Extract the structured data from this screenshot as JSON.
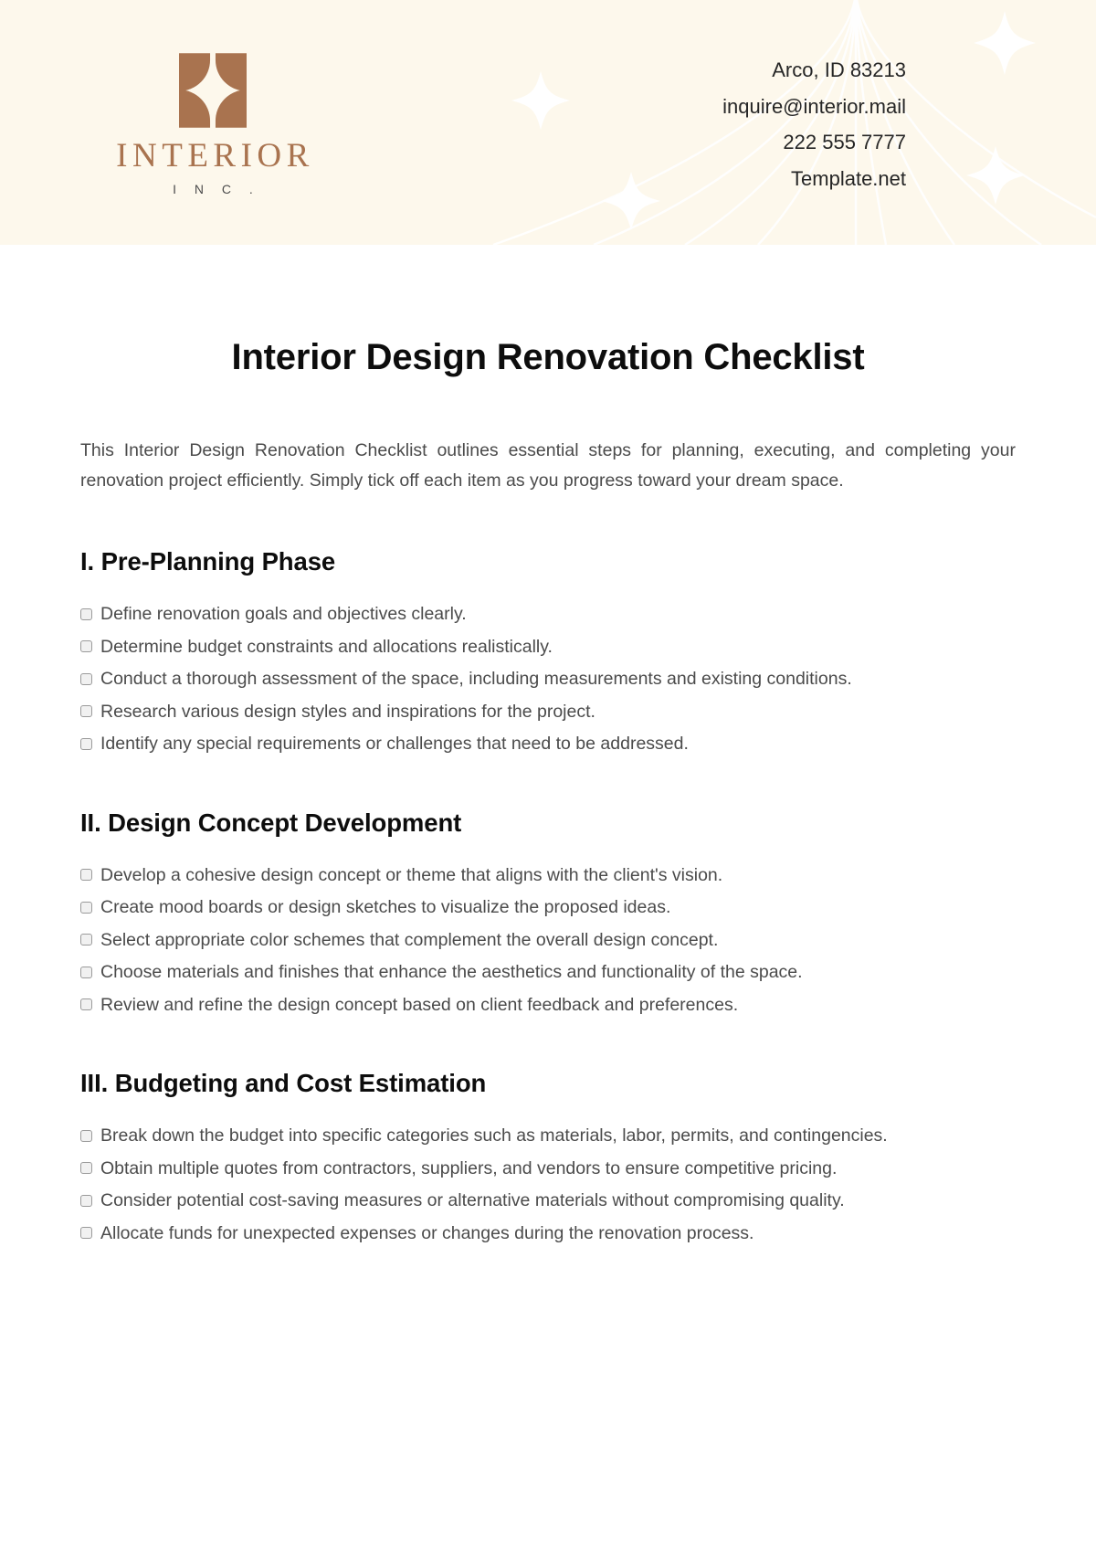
{
  "header": {
    "logo": {
      "mark_name": "interior-inc-logo-mark",
      "wordmark": "INTERIOR",
      "subtitle": "I N C .",
      "brand_color": "#a9734f"
    },
    "contact": [
      "Arco, ID 83213",
      "inquire@interior.mail",
      "222 555 7777",
      "Template.net"
    ],
    "background_color": "#fdf8ec",
    "decoration": "globe-meridian-lines-and-sparkles"
  },
  "document": {
    "title": "Interior Design Renovation Checklist",
    "intro": "This Interior Design Renovation Checklist outlines essential steps for planning, executing, and completing your renovation project efficiently. Simply tick off each item as you progress toward your dream space."
  },
  "sections": [
    {
      "heading": "I. Pre-Planning Phase",
      "items": [
        {
          "label": "Define renovation goals and objectives clearly.",
          "checked": false,
          "multiline": false
        },
        {
          "label": "Determine budget constraints and allocations realistically.",
          "checked": false,
          "multiline": false
        },
        {
          "label": "Conduct a thorough assessment of the space, including measurements and existing conditions.",
          "checked": false,
          "multiline": true
        },
        {
          "label": "Research various design styles and inspirations for the project.",
          "checked": false,
          "multiline": false
        },
        {
          "label": "Identify any special requirements or challenges that need to be addressed.",
          "checked": false,
          "multiline": false
        }
      ]
    },
    {
      "heading": "II. Design Concept Development",
      "items": [
        {
          "label": "Develop a cohesive design concept or theme that aligns with the client's vision.",
          "checked": false,
          "multiline": false
        },
        {
          "label": "Create mood boards or design sketches to visualize the proposed ideas.",
          "checked": false,
          "multiline": false
        },
        {
          "label": "Select appropriate color schemes that complement the overall design concept.",
          "checked": false,
          "multiline": false
        },
        {
          "label": "Choose materials and finishes that enhance the aesthetics and functionality of the space.",
          "checked": false,
          "multiline": true
        },
        {
          "label": "Review and refine the design concept based on client feedback and preferences.",
          "checked": false,
          "multiline": false
        }
      ]
    },
    {
      "heading": "III. Budgeting and Cost Estimation",
      "items": [
        {
          "label": "Break down the budget into specific categories such as materials, labor, permits, and contingencies.",
          "checked": false,
          "multiline": true
        },
        {
          "label": "Obtain multiple quotes from contractors, suppliers, and vendors to ensure competitive pricing.",
          "checked": false,
          "multiline": true
        },
        {
          "label": "Consider potential cost-saving measures or alternative materials without compromising quality.",
          "checked": false,
          "multiline": true
        },
        {
          "label": "Allocate funds for unexpected expenses or changes during the renovation process.",
          "checked": false,
          "multiline": false
        }
      ]
    }
  ]
}
